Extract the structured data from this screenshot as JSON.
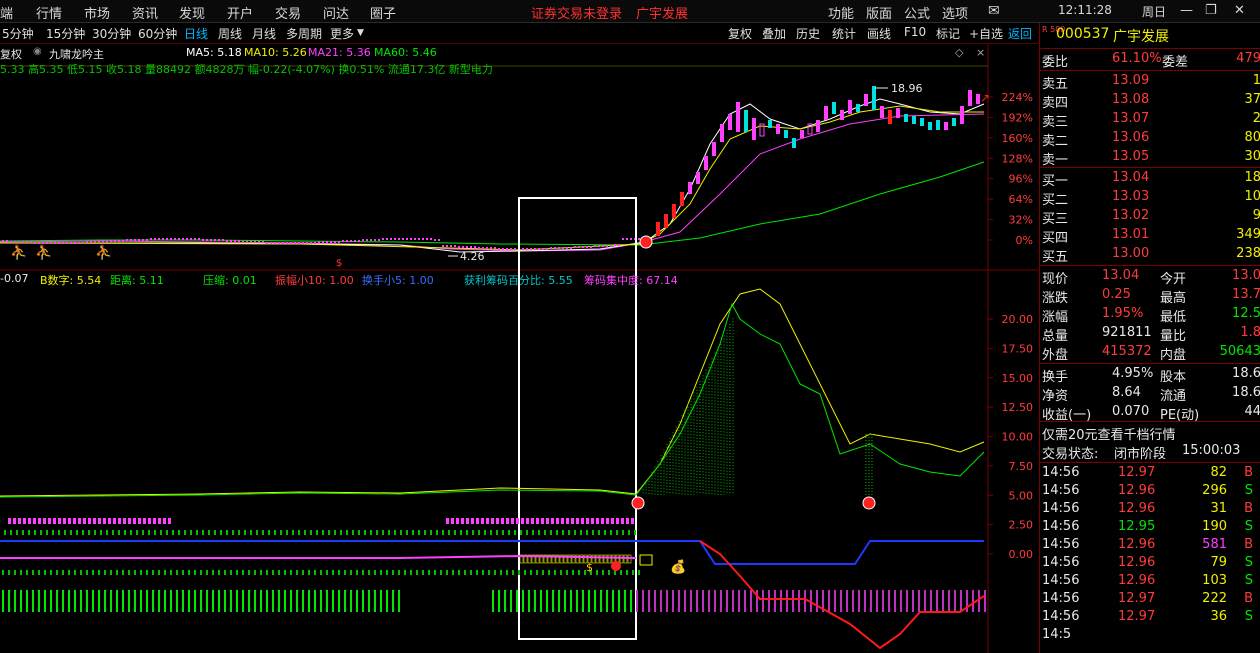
{
  "menubar": {
    "items": [
      "端",
      "行情",
      "市场",
      "资讯",
      "发现",
      "开户",
      "交易",
      "问达",
      "圈子"
    ],
    "alerts": [
      "证券交易未登录",
      "广宇发展"
    ],
    "right": [
      "功能",
      "版面",
      "公式",
      "选项"
    ],
    "time": "12:11:28",
    "weekday": "周日"
  },
  "periods": [
    "5分钟",
    "15分钟",
    "30分钟",
    "60分钟",
    "日线",
    "周线",
    "月线",
    "多周期",
    "更多"
  ],
  "active_period": "日线",
  "tools": [
    "复权",
    "叠加",
    "历史",
    "统计",
    "画线",
    "F10",
    "标记",
    "+自选",
    "返回"
  ],
  "main_chart": {
    "fq_label": "复权",
    "indicator_name": "九啸龙吟主",
    "ma": [
      {
        "label": "MA5: 5.18",
        "color": "#ffffff"
      },
      {
        "label": "MA10: 5.26",
        "color": "#f0f000"
      },
      {
        "label": "MA21: 5.36",
        "color": "#ff40ff"
      },
      {
        "label": "MA60: 5.46",
        "color": "#00e600"
      }
    ],
    "info_line": "5.33 高5.35 低5.15 收5.18 量88492 额4828万 幅-0.22(-4.07%) 换0.51% 流通17.3亿 新型电力",
    "high_label": "18.96",
    "low_label": "4.26",
    "pct_axis": [
      "224%",
      "192%",
      "160%",
      "128%",
      "96%",
      "64%",
      "32%",
      "0%"
    ]
  },
  "sub_chart": {
    "labels": [
      {
        "text": "-0.07",
        "color": "#e8e8e8"
      },
      {
        "text": "B数字: 5.54",
        "color": "#f0f000"
      },
      {
        "text": "距离: 5.11",
        "color": "#00e600"
      },
      {
        "text": "压缩: 0.01",
        "color": "#00e600"
      },
      {
        "text": "振幅小10: 1.00",
        "color": "#ff3c3c"
      },
      {
        "text": "换手小5: 1.00",
        "color": "#3a6cff"
      },
      {
        "text": "获利筹码百分比: 5.55",
        "color": "#00c8c8"
      },
      {
        "text": "筹码集中度: 67.14",
        "color": "#ff40ff"
      }
    ],
    "axis": [
      "20.00",
      "17.50",
      "15.00",
      "12.50",
      "10.00",
      "7.50",
      "5.00",
      "2.50",
      "0.00"
    ]
  },
  "quote": {
    "code": "000537",
    "name": "广宇发展",
    "market_tag": "R 500",
    "weibi_label": "委比",
    "weibi": "61.10%",
    "weicha_label": "委差",
    "weicha": "479",
    "asks": [
      {
        "label": "卖五",
        "price": "13.09",
        "vol": "1"
      },
      {
        "label": "卖四",
        "price": "13.08",
        "vol": "37"
      },
      {
        "label": "卖三",
        "price": "13.07",
        "vol": "2"
      },
      {
        "label": "卖二",
        "price": "13.06",
        "vol": "80"
      },
      {
        "label": "卖一",
        "price": "13.05",
        "vol": "30"
      }
    ],
    "bids": [
      {
        "label": "买一",
        "price": "13.04",
        "vol": "18"
      },
      {
        "label": "买二",
        "price": "13.03",
        "vol": "10"
      },
      {
        "label": "买三",
        "price": "13.02",
        "vol": "9"
      },
      {
        "label": "买四",
        "price": "13.01",
        "vol": "349"
      },
      {
        "label": "买五",
        "price": "13.00",
        "vol": "238"
      }
    ],
    "stats": [
      {
        "l1": "现价",
        "v1": "13.04",
        "c1": "red",
        "l2": "今开",
        "v2": "13.0",
        "c2": "red"
      },
      {
        "l1": "涨跌",
        "v1": "0.25",
        "c1": "red",
        "l2": "最高",
        "v2": "13.7",
        "c2": "red"
      },
      {
        "l1": "涨幅",
        "v1": "1.95%",
        "c1": "red",
        "l2": "最低",
        "v2": "12.5",
        "c2": "grn"
      },
      {
        "l1": "总量",
        "v1": "921811",
        "c1": "wht",
        "l2": "量比",
        "v2": "1.8",
        "c2": "red"
      },
      {
        "l1": "外盘",
        "v1": "415372",
        "c1": "red",
        "l2": "内盘",
        "v2": "50643",
        "c2": "grn"
      }
    ],
    "stats2": [
      {
        "l1": "换手",
        "v1": "4.95%",
        "c1": "wht",
        "l2": "股本",
        "v2": "18.6",
        "c2": "wht"
      },
      {
        "l1": "净资",
        "v1": "8.64",
        "c1": "wht",
        "l2": "流通",
        "v2": "18.6",
        "c2": "wht"
      },
      {
        "l1": "收益(一)",
        "v1": "0.070",
        "c1": "wht",
        "l2": "PE(动)",
        "v2": "44",
        "c2": "wht"
      }
    ],
    "promo": "仅需20元查看千档行情",
    "status_label": "交易状态:",
    "status": "闭市阶段",
    "status_time": "15:00:03",
    "ticks": [
      {
        "t": "14:56",
        "p": "12.97",
        "v": "82",
        "s": "B"
      },
      {
        "t": "14:56",
        "p": "12.96",
        "v": "296",
        "s": "S"
      },
      {
        "t": "14:56",
        "p": "12.96",
        "v": "31",
        "s": "B"
      },
      {
        "t": "14:56",
        "p": "12.95",
        "v": "190",
        "s": "S"
      },
      {
        "t": "14:56",
        "p": "12.96",
        "v": "581",
        "s": "B"
      },
      {
        "t": "14:56",
        "p": "12.96",
        "v": "79",
        "s": "S"
      },
      {
        "t": "14:56",
        "p": "12.96",
        "v": "103",
        "s": "S"
      },
      {
        "t": "14:56",
        "p": "12.97",
        "v": "222",
        "s": "B"
      },
      {
        "t": "14:56",
        "p": "12.97",
        "v": "36",
        "s": "S"
      },
      {
        "t": "14:5",
        "p": "",
        "v": "",
        "s": ""
      }
    ]
  }
}
